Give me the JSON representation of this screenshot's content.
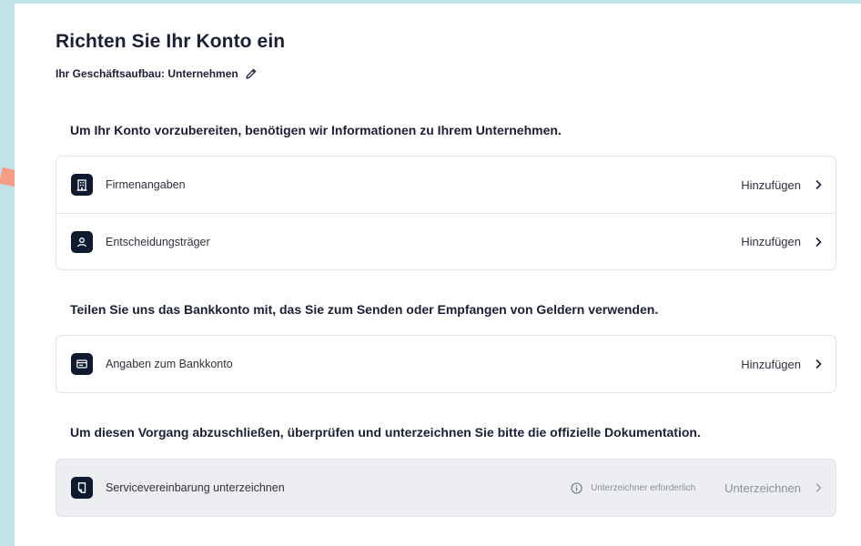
{
  "header": {
    "title": "Richten Sie Ihr Konto ein",
    "business_structure": "Ihr Geschäftsaufbau: Unternehmen"
  },
  "sections": [
    {
      "heading": "Um Ihr Konto vorzubereiten, benötigen wir Informationen zu Ihrem Unternehmen.",
      "items": [
        {
          "label": "Firmenangaben",
          "action": "Hinzufügen",
          "icon": "building-icon"
        },
        {
          "label": "Entscheidungsträger",
          "action": "Hinzufügen",
          "icon": "person-icon"
        }
      ]
    },
    {
      "heading": "Teilen Sie uns das Bankkonto mit, das Sie zum Senden oder Empfangen von Geldern verwenden.",
      "items": [
        {
          "label": "Angaben zum Bankkonto",
          "action": "Hinzufügen",
          "icon": "bank-icon"
        }
      ]
    },
    {
      "heading": "Um diesen Vorgang abzuschließen, überprüfen und unterzeichnen Sie bitte die offizielle Dokumentation.",
      "items": [
        {
          "label": "Servicevereinbarung unterzeichnen",
          "note": "Unterzeichner erforderlich",
          "action": "Unterzeichnen",
          "icon": "document-icon",
          "disabled": true
        }
      ]
    }
  ],
  "colors": {
    "background": "#bfe3e7",
    "icon_tile": "#0e1a2e",
    "annotation_arrow": "#f79c84",
    "disabled_row": "#eceef1"
  }
}
